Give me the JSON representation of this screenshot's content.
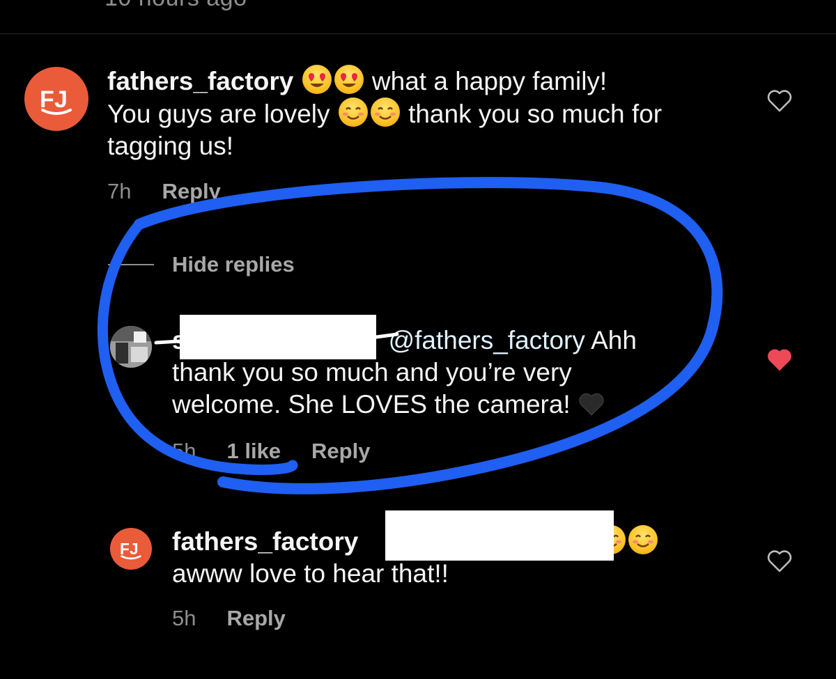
{
  "top_fragment": "10 hours ago",
  "comment_main": {
    "username": "fathers_factory",
    "text_part1": "what a happy family!",
    "text_part2": "You guys are lovely",
    "text_part3": "thank you so much for tagging us!",
    "time": "7h",
    "reply_label": "Reply",
    "emojis": [
      "heart-eyes-emoji",
      "smiling-blush-emoji"
    ]
  },
  "hide_replies_label": "Hide replies",
  "reply_1": {
    "username_initial": "s",
    "mention": "@fathers_factory",
    "text": "Ahh thank you so much and you’re very welcome. She LOVES the camera!",
    "time": "5h",
    "likes": "1 like",
    "reply_label": "Reply",
    "liked": true
  },
  "reply_2": {
    "username": "fathers_factory",
    "text": "awww love to hear that!!",
    "time": "5h",
    "reply_label": "Reply"
  },
  "colors": {
    "background": "#000000",
    "brand_orange": "#ea5b3a",
    "like_red": "#ed4956",
    "annotation_blue": "#1f5ff2",
    "muted_text": "#8e8e8e"
  },
  "icons": [
    "heart-outline-icon",
    "heart-filled-icon",
    "fathers-factory-logo"
  ]
}
